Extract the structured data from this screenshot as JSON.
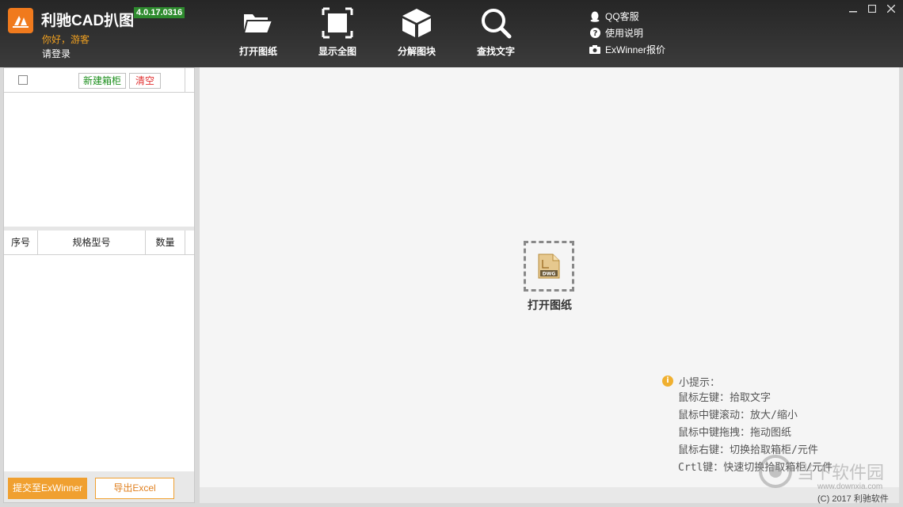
{
  "app": {
    "title": "利驰CAD扒图",
    "version": "4.0.17.0316",
    "greeting": "你好，游客",
    "login": "请登录",
    "logo_icon": "lichi-logo-icon",
    "accent_color": "#f07a1d"
  },
  "toolbar": [
    {
      "label": "打开图纸",
      "icon": "folder-open-icon"
    },
    {
      "label": "显示全图",
      "icon": "fit-screen-icon"
    },
    {
      "label": "分解图块",
      "icon": "cube-icon"
    },
    {
      "label": "查找文字",
      "icon": "search-icon"
    }
  ],
  "links": [
    {
      "label": "QQ客服",
      "icon": "qq-icon"
    },
    {
      "label": "使用说明",
      "icon": "help-icon"
    },
    {
      "label": "ExWinner报价",
      "icon": "camera-icon"
    }
  ],
  "cabinet": {
    "new_label": "新建箱柜",
    "clear_label": "清空"
  },
  "table": {
    "headers": [
      "序号",
      "规格型号",
      "数量"
    ]
  },
  "actions": {
    "submit_label": "提交至ExWinner",
    "export_label": "导出Excel"
  },
  "canvas": {
    "open_label": "打开图纸",
    "file_icon_text": "DWG"
  },
  "tips": {
    "title": "小提示：",
    "lines": [
      "鼠标左键：拾取文字",
      "鼠标中键滚动：放大/缩小",
      "鼠标中键拖拽：拖动图纸",
      "鼠标右键：切换拾取箱柜/元件",
      "Crtl键：快速切换拾取箱柜/元件"
    ]
  },
  "watermark": {
    "text": "当下软件园",
    "url": "www.downxia.com"
  },
  "copyright": "(C) 2017 利驰软件"
}
